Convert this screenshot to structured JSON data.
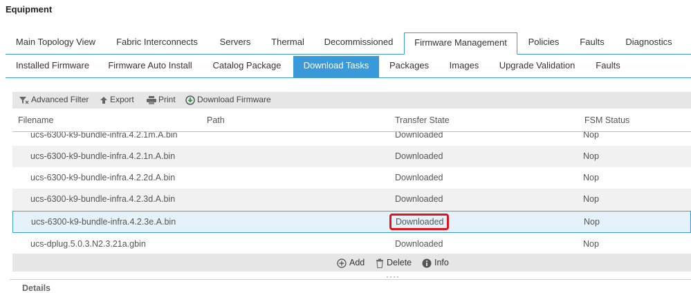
{
  "page": {
    "title": "Equipment"
  },
  "main_tabs": [
    {
      "label": "Main Topology View",
      "active": false
    },
    {
      "label": "Fabric Interconnects",
      "active": false
    },
    {
      "label": "Servers",
      "active": false
    },
    {
      "label": "Thermal",
      "active": false
    },
    {
      "label": "Decommissioned",
      "active": false
    },
    {
      "label": "Firmware Management",
      "active": true
    },
    {
      "label": "Policies",
      "active": false
    },
    {
      "label": "Faults",
      "active": false
    },
    {
      "label": "Diagnostics",
      "active": false
    }
  ],
  "sub_tabs": [
    {
      "label": "Installed Firmware",
      "active": false
    },
    {
      "label": "Firmware Auto Install",
      "active": false
    },
    {
      "label": "Catalog Package",
      "active": false
    },
    {
      "label": "Download Tasks",
      "active": true
    },
    {
      "label": "Packages",
      "active": false
    },
    {
      "label": "Images",
      "active": false
    },
    {
      "label": "Upgrade Validation",
      "active": false
    },
    {
      "label": "Faults",
      "active": false
    }
  ],
  "toolbar": {
    "advanced_filter": "Advanced Filter",
    "export": "Export",
    "print": "Print",
    "download_firmware": "Download Firmware"
  },
  "table": {
    "columns": [
      "Filename",
      "Path",
      "Transfer State",
      "FSM Status"
    ],
    "rows": [
      {
        "filename": "ucs-6300-k9-bundle-infra.4.2.1m.A.bin",
        "path": "",
        "transfer_state": "Downloaded",
        "fsm_status": "Nop"
      },
      {
        "filename": "ucs-6300-k9-bundle-infra.4.2.1n.A.bin",
        "path": "",
        "transfer_state": "Downloaded",
        "fsm_status": "Nop"
      },
      {
        "filename": "ucs-6300-k9-bundle-infra.4.2.2d.A.bin",
        "path": "",
        "transfer_state": "Downloaded",
        "fsm_status": "Nop"
      },
      {
        "filename": "ucs-6300-k9-bundle-infra.4.2.3d.A.bin",
        "path": "",
        "transfer_state": "Downloaded",
        "fsm_status": "Nop"
      },
      {
        "filename": "ucs-6300-k9-bundle-infra.4.2.3e.A.bin",
        "path": "",
        "transfer_state": "Downloaded",
        "fsm_status": "Nop"
      },
      {
        "filename": "ucs-dplug.5.0.3.N2.3.21a.gbin",
        "path": "",
        "transfer_state": "Downloaded",
        "fsm_status": "Nop"
      }
    ],
    "selected_row": 4
  },
  "footer": {
    "add": "Add",
    "delete": "Delete",
    "info": "Info"
  },
  "details": {
    "title": "Details"
  },
  "colors": {
    "accent": "#3a9ad9",
    "highlight": "#e0141e"
  }
}
